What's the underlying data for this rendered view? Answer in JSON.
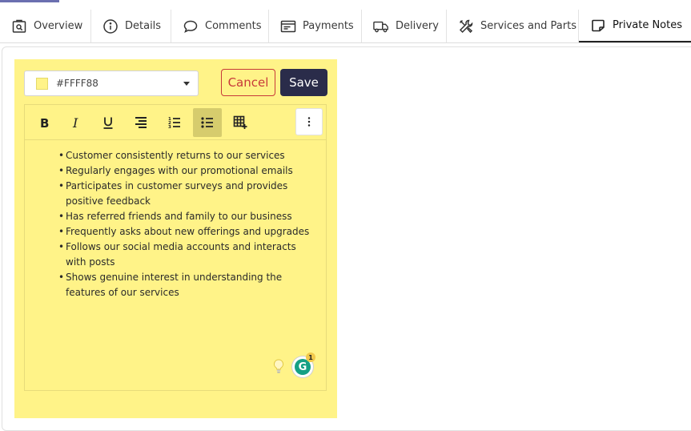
{
  "tabs": [
    {
      "label": "Overview",
      "icon": "search-document-icon"
    },
    {
      "label": "Details",
      "icon": "info-icon"
    },
    {
      "label": "Comments",
      "icon": "comment-icon"
    },
    {
      "label": "Payments",
      "icon": "invoice-icon"
    },
    {
      "label": "Delivery",
      "icon": "truck-icon"
    },
    {
      "label": "Services and Parts",
      "icon": "tools-icon"
    },
    {
      "label": "Private Notes",
      "icon": "sticky-note-icon",
      "active": true
    }
  ],
  "note": {
    "color": "#FFF388",
    "color_value": "#FFFF88",
    "cancel_label": "Cancel",
    "save_label": "Save",
    "items": [
      "Customer consistently returns to our services",
      "Regularly engages with our promotional emails",
      "Participates in customer surveys and provides positive feedback",
      "Has referred friends and family to our business",
      "Frequently asks about new offerings and upgrades",
      "Follows our social media accounts and interacts with posts",
      "Shows genuine interest in understanding the features of our services"
    ],
    "grammarly_count": "1"
  },
  "colors": {
    "accent_dark": "#2a2c4a",
    "cancel_red": "#c73a3a",
    "grammarly_green": "#15a084"
  }
}
